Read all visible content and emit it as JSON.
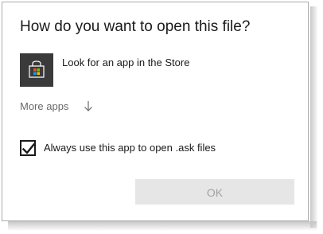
{
  "dialog": {
    "title": "How do you want to open this file?",
    "store_option": {
      "label": "Look for an app in the Store",
      "icon": "store-icon"
    },
    "more_apps": {
      "label": "More apps",
      "icon": "arrow-down-icon"
    },
    "always_use": {
      "label": "Always use this app to open .ask files",
      "checked": true
    },
    "ok_button": {
      "label": "OK",
      "disabled": true
    }
  },
  "colors": {
    "store_tile_background": "#3a3a3a",
    "ok_button_background": "#e6e6e6",
    "ok_button_text": "#a2a2a2",
    "more_apps_text": "#6a6a6a"
  }
}
